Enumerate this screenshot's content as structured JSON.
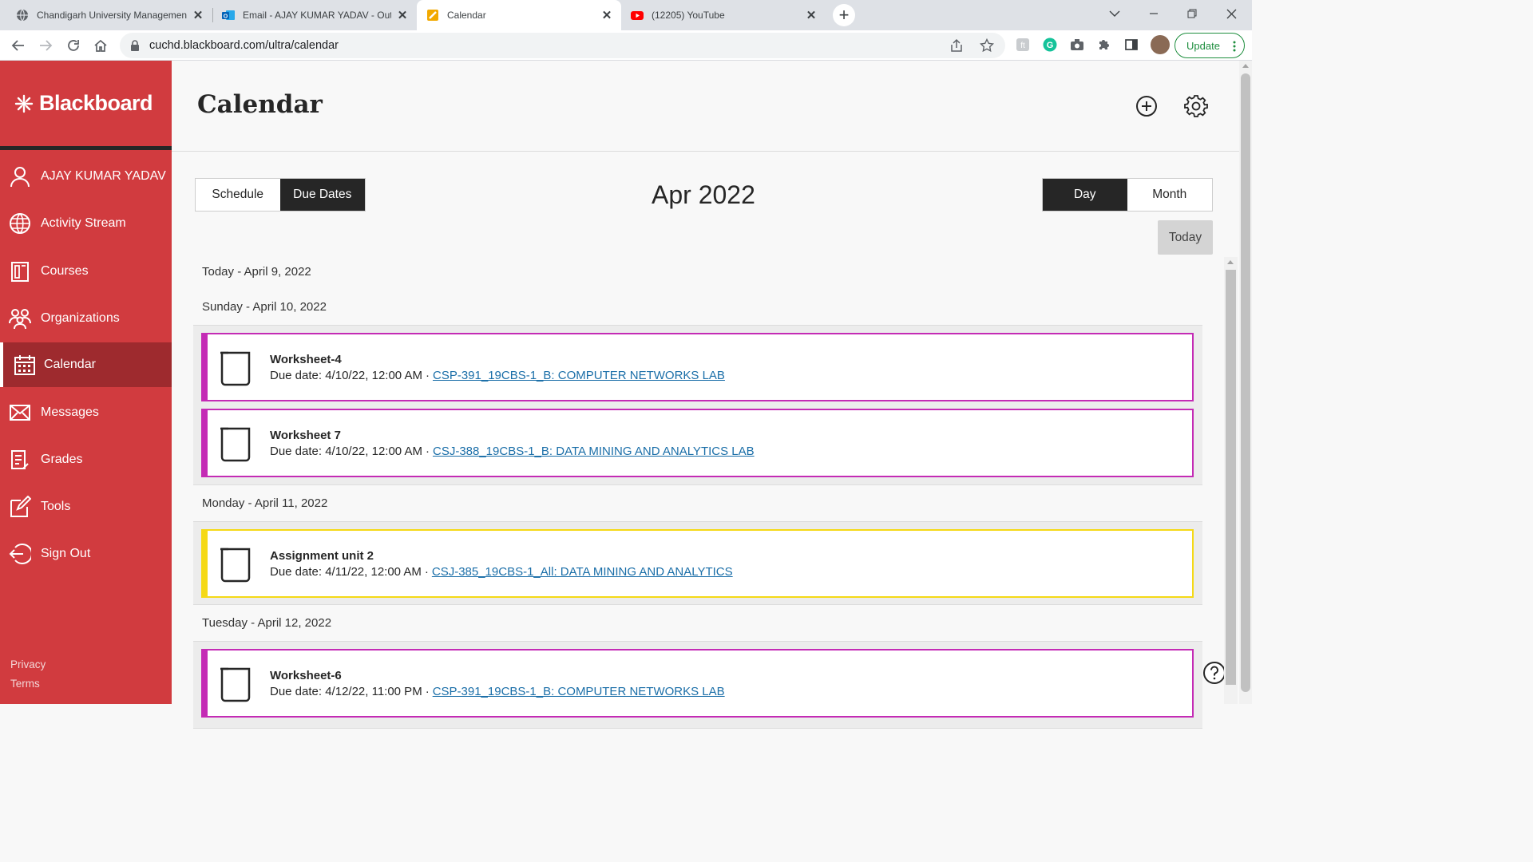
{
  "browser": {
    "tabs": [
      {
        "title": "Chandigarh University Management",
        "icon": "globe-icon"
      },
      {
        "title": "Email - AJAY KUMAR YADAV - Outlo",
        "icon": "outlook-icon"
      },
      {
        "title": "Calendar",
        "icon": "blackboard-favicon"
      },
      {
        "title": "(12205) YouTube",
        "icon": "youtube-icon"
      }
    ],
    "url": "cuchd.blackboard.com/ultra/calendar",
    "update_label": "Update"
  },
  "sidebar": {
    "logo": "Blackboard",
    "items": [
      {
        "label": "AJAY KUMAR YADAV",
        "icon": "user-icon"
      },
      {
        "label": "Activity Stream",
        "icon": "globe-icon"
      },
      {
        "label": "Courses",
        "icon": "courses-icon"
      },
      {
        "label": "Organizations",
        "icon": "organizations-icon"
      },
      {
        "label": "Calendar",
        "icon": "calendar-icon"
      },
      {
        "label": "Messages",
        "icon": "envelope-icon"
      },
      {
        "label": "Grades",
        "icon": "grades-icon"
      },
      {
        "label": "Tools",
        "icon": "tools-icon"
      },
      {
        "label": "Sign Out",
        "icon": "sign-out-icon"
      }
    ],
    "privacy": "Privacy",
    "terms": "Terms"
  },
  "page": {
    "title": "Calendar",
    "view_tabs": {
      "schedule": "Schedule",
      "due_dates": "Due Dates"
    },
    "month": "Apr 2022",
    "range_tabs": {
      "day": "Day",
      "month": "Month"
    },
    "today_button": "Today"
  },
  "days": [
    {
      "heading": "Today - April 9, 2022",
      "events": []
    },
    {
      "heading": "Sunday - April 10, 2022",
      "events": [
        {
          "title": "Worksheet-4",
          "due": "Due date: 4/10/22, 12:00 AM",
          "course": "CSP-391_19CBS-1_B: COMPUTER NETWORKS LAB",
          "color": "#c42bb5"
        },
        {
          "title": "Worksheet 7",
          "due": "Due date: 4/10/22, 12:00 AM",
          "course": "CSJ-388_19CBS-1_B: DATA MINING AND ANALYTICS LAB",
          "color": "#c42bb5"
        }
      ]
    },
    {
      "heading": "Monday - April 11, 2022",
      "events": [
        {
          "title": "Assignment unit 2",
          "due": "Due date: 4/11/22, 12:00 AM",
          "course": "CSJ-385_19CBS-1_All: DATA MINING AND ANALYTICS",
          "color": "#f5d916"
        }
      ]
    },
    {
      "heading": "Tuesday - April 12, 2022",
      "events": [
        {
          "title": "Worksheet-6",
          "due": "Due date: 4/12/22, 11:00 PM",
          "course": "CSP-391_19CBS-1_B: COMPUTER NETWORKS LAB",
          "color": "#c42bb5"
        }
      ]
    }
  ],
  "colors": {
    "sidebar": "#d13b3f",
    "sidebar_active": "#9e2a2e",
    "link": "#1a6ea8"
  }
}
